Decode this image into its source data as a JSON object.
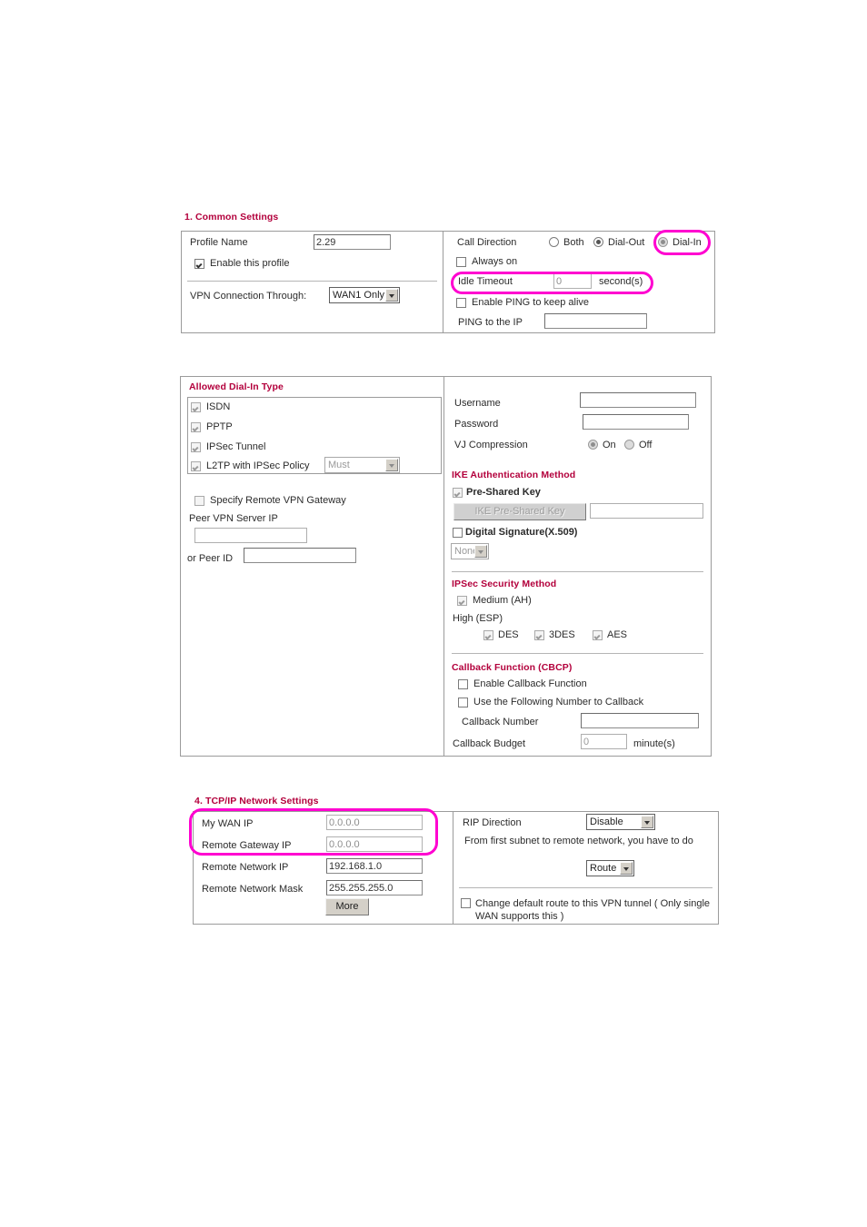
{
  "sections": {
    "common": {
      "heading": "1. Common Settings",
      "profile_name_label": "Profile Name",
      "profile_name_value": "2.29",
      "enable_profile_label": "Enable this profile",
      "vpn_through_label": "VPN Connection Through:",
      "vpn_through_value": "WAN1 Only",
      "call_direction_label": "Call Direction",
      "call_both_label": "Both",
      "call_dialout_label": "Dial-Out",
      "call_dialin_label": "Dial-In",
      "always_on_label": "Always on",
      "idle_timeout_label": "Idle Timeout",
      "idle_timeout_value": "0",
      "idle_timeout_unit": "second(s)",
      "enable_ping_label": "Enable PING to keep alive",
      "ping_ip_label": "PING to the IP",
      "ping_ip_value": ""
    },
    "dialin": {
      "heading": "Allowed Dial-In Type",
      "types": [
        {
          "label": "ISDN"
        },
        {
          "label": "PPTP"
        },
        {
          "label": "IPSec Tunnel"
        },
        {
          "label": "L2TP with IPSec Policy"
        }
      ],
      "l2tp_policy_value": "Must",
      "specify_gateway_label": "Specify Remote VPN Gateway",
      "peer_vpn_server_ip_label": "Peer VPN Server IP",
      "peer_vpn_server_ip_value": "",
      "or_peer_id_label": "or Peer ID",
      "or_peer_id_value": "",
      "username_label": "Username",
      "username_value": "",
      "password_label": "Password",
      "password_value": "",
      "vj_compression_label": "VJ Compression",
      "vj_on_label": "On",
      "vj_off_label": "Off",
      "ike_heading": "IKE Authentication Method",
      "pre_shared_key_label": "Pre-Shared Key",
      "ike_psk_button": "IKE Pre-Shared Key",
      "ike_psk_value": "",
      "digital_signature_label": "Digital Signature(X.509)",
      "digital_signature_select": "None",
      "ipsec_heading": "IPSec Security Method",
      "medium_ah_label": "Medium (AH)",
      "high_esp_label": "High (ESP)",
      "des_label": "DES",
      "tripledes_label": "3DES",
      "aes_label": "AES",
      "callback_heading": "Callback Function (CBCP)",
      "enable_callback_label": "Enable Callback Function",
      "use_following_number_label": "Use the Following Number to Callback",
      "callback_number_label": "Callback Number",
      "callback_number_value": "",
      "callback_budget_label": "Callback Budget",
      "callback_budget_value": "0",
      "callback_budget_unit": "minute(s)"
    },
    "tcpip": {
      "heading": "4. TCP/IP Network Settings",
      "my_wan_ip_label": "My WAN IP",
      "my_wan_ip_value": "0.0.0.0",
      "remote_gateway_ip_label": "Remote Gateway IP",
      "remote_gateway_ip_value": "0.0.0.0",
      "remote_network_ip_label": "Remote Network IP",
      "remote_network_ip_value": "192.168.1.0",
      "remote_network_mask_label": "Remote Network Mask",
      "remote_network_mask_value": "255.255.255.0",
      "more_button": "More",
      "rip_direction_label": "RIP Direction",
      "rip_direction_value": "Disable",
      "subnet_note": "From first subnet to remote network, you have to do",
      "route_select_value": "Route",
      "change_default_route_label": "Change default route to this VPN tunnel ( Only single WAN supports this )"
    }
  },
  "colors": {
    "heading": "#b3003c",
    "highlight": "#ff00d0",
    "border": "#9b9b9b"
  }
}
